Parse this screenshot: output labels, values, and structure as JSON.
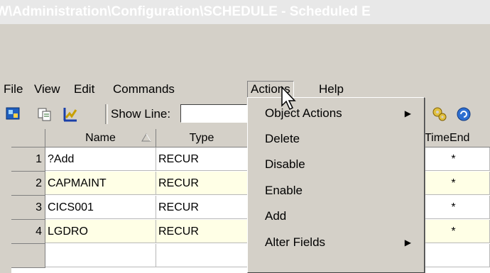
{
  "window": {
    "title": "W\\Administration\\Configuration\\SCHEDULE - Scheduled E"
  },
  "menubar": {
    "items": [
      "File",
      "View",
      "Edit",
      "Commands",
      "Actions",
      "Help"
    ],
    "active": "Actions"
  },
  "toolbar": {
    "icons": [
      "tools-icon",
      "copy-icon",
      "chart-icon"
    ],
    "show_line_label": "Show Line:",
    "show_line_value": "",
    "right_icons": [
      "gears-icon",
      "refresh-icon"
    ]
  },
  "table": {
    "columns": [
      "Name",
      "Type",
      "TimeEnd"
    ],
    "rows": [
      {
        "num": "1",
        "name": "?Add",
        "type": "RECUR",
        "timeend": "*"
      },
      {
        "num": "2",
        "name": "CAPMAINT",
        "type": "RECUR",
        "timeend": "*"
      },
      {
        "num": "3",
        "name": "CICS001",
        "type": "RECUR",
        "timeend": "*"
      },
      {
        "num": "4",
        "name": "LGDRO",
        "type": "RECUR",
        "timeend": "*"
      }
    ],
    "stripe_color": "#ffffe6"
  },
  "actions_menu": {
    "items": [
      {
        "label": "Object Actions",
        "submenu": true
      },
      {
        "label": "Delete",
        "submenu": false
      },
      {
        "label": "Disable",
        "submenu": false
      },
      {
        "label": "Enable",
        "submenu": false
      },
      {
        "label": "Add",
        "submenu": false
      },
      {
        "label": "Alter Fields",
        "submenu": true
      }
    ]
  }
}
